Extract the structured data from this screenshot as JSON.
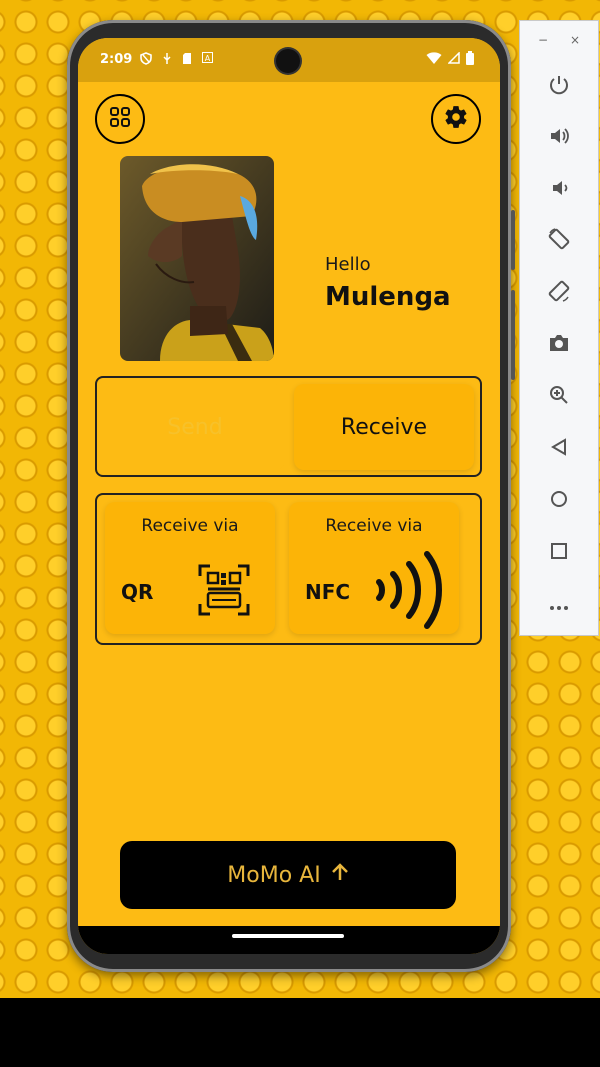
{
  "status_bar": {
    "time": "2:09"
  },
  "header": {
    "menu_icon": "grid-icon",
    "settings_icon": "gear-icon"
  },
  "profile": {
    "greeting": "Hello",
    "name": "Mulenga"
  },
  "tabs": {
    "send_label": "Send",
    "receive_label": "Receive",
    "selected": "Receive"
  },
  "receive_options": [
    {
      "title": "Receive via",
      "method": "QR",
      "icon": "qr-code-icon"
    },
    {
      "title": "Receive via",
      "method": "NFC",
      "icon": "nfc-icon"
    }
  ],
  "ai_button": {
    "label": "MoMo AI",
    "icon": "arrow-up-icon"
  },
  "emulator_panel": {
    "window_controls": {
      "minimize": "−",
      "close": "×"
    },
    "tools": [
      "power-icon",
      "volume-up-icon",
      "volume-down-icon",
      "rotate-left-icon",
      "rotate-right-icon",
      "camera-icon",
      "zoom-icon",
      "back-icon",
      "home-icon",
      "overview-icon",
      "more-icon"
    ]
  },
  "colors": {
    "screen_bg": "#fdbb14",
    "accent_text": "#e8b63c",
    "button_bg": "#000000"
  }
}
